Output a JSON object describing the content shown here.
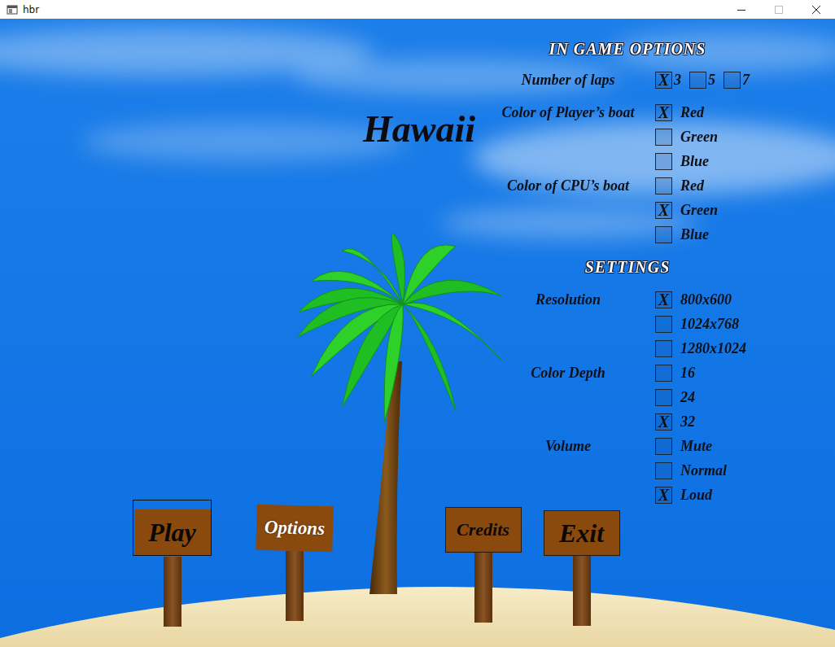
{
  "window": {
    "title": "hbr"
  },
  "title": "Hawaii",
  "check_mark": "X",
  "in_game_options": {
    "heading": "IN GAME OPTIONS",
    "groups": [
      {
        "label": "Number of laps",
        "kind": "inline",
        "choices": [
          {
            "label": "3",
            "selected": true
          },
          {
            "label": "5",
            "selected": false
          },
          {
            "label": "7",
            "selected": false
          }
        ]
      },
      {
        "label": "Color of Player’s boat",
        "kind": "stacked",
        "choices": [
          {
            "label": "Red",
            "selected": true
          },
          {
            "label": "Green",
            "selected": false
          },
          {
            "label": "Blue",
            "selected": false
          }
        ]
      },
      {
        "label": "Color of CPU’s boat",
        "kind": "stacked",
        "choices": [
          {
            "label": "Red",
            "selected": false
          },
          {
            "label": "Green",
            "selected": true
          },
          {
            "label": "Blue",
            "selected": false
          }
        ]
      }
    ]
  },
  "settings": {
    "heading": "SETTINGS",
    "groups": [
      {
        "label": "Resolution",
        "kind": "stacked",
        "choices": [
          {
            "label": "800x600",
            "selected": true
          },
          {
            "label": "1024x768",
            "selected": false
          },
          {
            "label": "1280x1024",
            "selected": false
          }
        ]
      },
      {
        "label": "Color Depth",
        "kind": "stacked",
        "choices": [
          {
            "label": "16",
            "selected": false
          },
          {
            "label": "24",
            "selected": false
          },
          {
            "label": "32",
            "selected": true
          }
        ]
      },
      {
        "label": "Volume",
        "kind": "stacked",
        "choices": [
          {
            "label": "Mute",
            "selected": false
          },
          {
            "label": "Normal",
            "selected": false
          },
          {
            "label": "Loud",
            "selected": true
          }
        ]
      }
    ]
  },
  "buttons": [
    {
      "label": "Play",
      "selected": true,
      "hover": false
    },
    {
      "label": "Options",
      "selected": false,
      "hover": true
    },
    {
      "label": "Credits",
      "selected": false,
      "hover": false
    },
    {
      "label": "Exit",
      "selected": false,
      "hover": false
    }
  ]
}
